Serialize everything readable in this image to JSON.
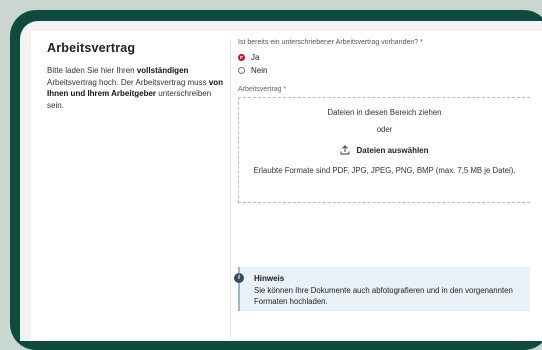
{
  "section": {
    "title": "Arbeitsvertrag",
    "description_parts": [
      {
        "text": "Bitte laden Sie hier Ihren ",
        "bold": false
      },
      {
        "text": "vollständigen",
        "bold": true
      },
      {
        "text": " Arbeitsvertrag hoch. Der Arbeitsvertrag muss ",
        "bold": false
      },
      {
        "text": "von Ihnen und Ihrem Arbeitgeber",
        "bold": true
      },
      {
        "text": " unterschreiben sein.",
        "bold": false
      }
    ]
  },
  "question": {
    "label": "Ist bereits ein unterschriebener Arbeitsvertrag vorhanden? *",
    "options": [
      {
        "label": "Ja",
        "selected": true
      },
      {
        "label": "Nein",
        "selected": false
      }
    ]
  },
  "upload": {
    "label": "Arbeitsvertrag *",
    "drag_text": "Dateien in diesen Bereich ziehen",
    "or_text": "oder",
    "choose_label": "Dateien auswählen",
    "formats_text": "Erlaubte Formate sind PDF, JPG, JPEG, PNG, BMP (max. 7,5 MB je Datei).",
    "icon": "upload-icon"
  },
  "hint": {
    "title": "Hinweis",
    "text": "Sie können Ihre Dokumente auch abfotografieren und in den vorgenannten Formaten hochladen.",
    "icon": "info-icon"
  },
  "colors": {
    "frame": "#0f4a3e",
    "radio_selected": "#c9142f",
    "hint_background": "#e9f0f6"
  }
}
